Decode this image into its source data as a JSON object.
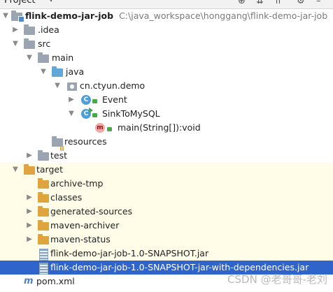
{
  "header": {
    "title": "Project"
  },
  "tree": {
    "root": {
      "label": "flink-demo-jar-job",
      "path": "C:\\java_workspace\\honggang\\flink-demo-jar-job"
    },
    "idea": {
      "label": ".idea"
    },
    "src": {
      "label": "src"
    },
    "main": {
      "label": "main"
    },
    "java": {
      "label": "java"
    },
    "package": {
      "label": "cn.ctyun.demo"
    },
    "event": {
      "label": "Event"
    },
    "sink": {
      "label": "SinkToMySQL"
    },
    "method": {
      "label": "main(String[]):void"
    },
    "resources": {
      "label": "resources"
    },
    "test": {
      "label": "test"
    },
    "target": {
      "label": "target"
    },
    "archive_tmp": {
      "label": "archive-tmp"
    },
    "classes": {
      "label": "classes"
    },
    "generated_sources": {
      "label": "generated-sources"
    },
    "maven_archiver": {
      "label": "maven-archiver"
    },
    "maven_status": {
      "label": "maven-status"
    },
    "jar": {
      "label": "flink-demo-jar-job-1.0-SNAPSHOT.jar"
    },
    "jar_deps": {
      "label": "flink-demo-jar-job-1.0-SNAPSHOT-jar-with-dependencies.jar"
    },
    "pom": {
      "label": "pom.xml"
    }
  },
  "watermark": "CSDN @老哥哥-老刘",
  "colors": {
    "selection": "#2f65ca",
    "excluded_bg": "#fffde7"
  }
}
